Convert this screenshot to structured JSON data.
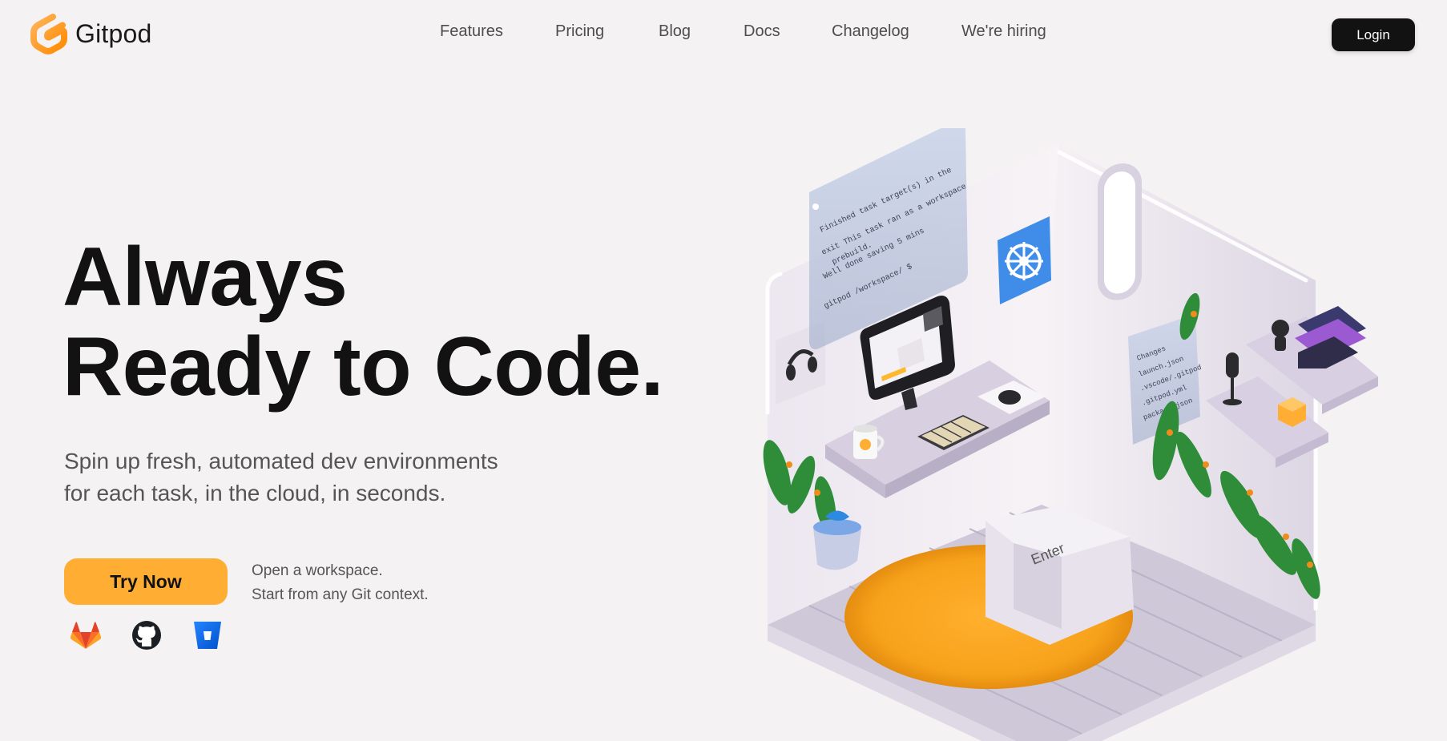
{
  "header": {
    "brand": "Gitpod",
    "nav": [
      {
        "label": "Features"
      },
      {
        "label": "Pricing"
      },
      {
        "label": "Blog"
      },
      {
        "label": "Docs"
      },
      {
        "label": "Changelog"
      },
      {
        "label": "We're hiring"
      }
    ],
    "login_label": "Login"
  },
  "hero": {
    "title_line1": "Always",
    "title_line2": "Ready to Code.",
    "subtitle_line1": "Spin up fresh, automated dev environments",
    "subtitle_line2": "for each task, in the cloud, in seconds.",
    "cta_label": "Try Now",
    "cta_note_line1": "Open a workspace.",
    "cta_note_line2": "Start from any Git context.",
    "providers": [
      {
        "name": "gitlab",
        "icon": "gitlab-icon"
      },
      {
        "name": "github",
        "icon": "github-icon"
      },
      {
        "name": "bitbucket",
        "icon": "bitbucket-icon"
      }
    ]
  },
  "illustration": {
    "screen_lines": [
      "Finished task target(s) in the",
      "exit  This task ran as a workspace",
      "prebuild.",
      "Well done saving 5 mins",
      "gitpod /workspace/ $"
    ],
    "side_panel_lines": [
      "Changes",
      "launch.json",
      ".vscode/.gitpod",
      ".gitpod.yml",
      "package.json"
    ],
    "key_label": "Enter"
  },
  "colors": {
    "background": "#f4f2f3",
    "brand_orange": "#ffae33",
    "logo_orange": "#ff8a00",
    "login_bg": "#121212",
    "text_dark": "#121212",
    "text_muted": "#555555"
  }
}
